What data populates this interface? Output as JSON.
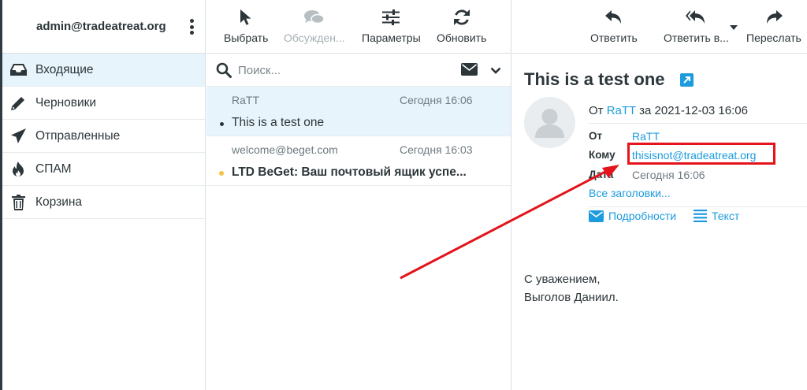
{
  "account": {
    "email": "admin@tradeatreat.org"
  },
  "folders": [
    {
      "label": "Входящие",
      "icon": "inbox-icon",
      "active": true
    },
    {
      "label": "Черновики",
      "icon": "pencil-icon"
    },
    {
      "label": "Отправленные",
      "icon": "paper-plane-icon"
    },
    {
      "label": "СПАМ",
      "icon": "fire-icon"
    },
    {
      "label": "Корзина",
      "icon": "trash-icon"
    }
  ],
  "list_toolbar": {
    "select": "Выбрать",
    "threads": "Обсужден...",
    "options": "Параметры",
    "refresh": "Обновить"
  },
  "search": {
    "placeholder": "Поиск..."
  },
  "messages": [
    {
      "from": "RaTT",
      "date": "Сегодня 16:06",
      "subject": "This is a test one",
      "selected": true,
      "unread": false
    },
    {
      "from": "welcome@beget.com",
      "date": "Сегодня 16:03",
      "subject": "LTD BeGet: Ваш почтовый ящик успе...",
      "selected": false,
      "unread": true
    }
  ],
  "reader_toolbar": {
    "reply": "Ответить",
    "reply_all": "Ответить в...",
    "forward": "Переслать"
  },
  "message": {
    "subject": "This is a test one",
    "from_prefix": "От",
    "from_name": "RaTT",
    "date_prefix": "за",
    "datetime": "2021-12-03 16:06",
    "headers": {
      "from_label": "От",
      "from_value": "RaTT",
      "to_label": "Кому",
      "to_value": "thisisnot@tradeatreat.org",
      "date_label": "Дата",
      "date_value": "Сегодня 16:06"
    },
    "all_headers": "Все заголовки...",
    "details": "Подробности",
    "plain_text": "Текст",
    "body_line1": "С уважением,",
    "body_line2": "Выголов Даниил."
  },
  "colors": {
    "accent": "#1c9bde",
    "selected_bg": "#e8f4fb",
    "annotation": "#e3141b",
    "unread_dot": "#f5c242",
    "text": "#2c363a"
  }
}
